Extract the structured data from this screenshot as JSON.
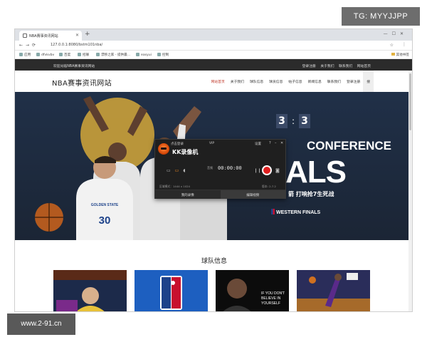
{
  "watermarks": {
    "top_right": "TG: MYYJJPP",
    "bottom_left": "www.2-91.cn"
  },
  "browser": {
    "tab_title": "NBA赛事资讯网站",
    "new_tab": "+",
    "address": "127.0.0.1:8080/bstm101nba/",
    "bookmarks": [
      "应用",
      "dfvkvbv",
      "百度",
      "招联",
      "漂移之家 - 提供最...",
      "easyui",
      "控制"
    ],
    "bookmarks_other": "其他书签"
  },
  "site": {
    "welcome": "欢迎光临NBA赛事资讯网站",
    "top_links": [
      "登录注册",
      "关于我们",
      "联系我们",
      "网站首页"
    ],
    "logo": "NBA赛事资讯网站",
    "nav": [
      "网站首页",
      "关于我们",
      "球队信息",
      "球员信息",
      "帖子信息",
      "新闻信息",
      "联系我们",
      "登录注册",
      "搜"
    ],
    "banner": {
      "score_left": "3",
      "score_right": "3",
      "conference": "CONFERENCE",
      "finals": "ALS",
      "slogan": "箭 打响抢7生死战",
      "western": "WESTERN FINALS"
    },
    "section_title": "球队信息"
  },
  "recorder": {
    "login": "点击登录",
    "vip": "VIP",
    "settings": "设置",
    "title": "KK录像机",
    "audio_label": "音频",
    "timer": "00:00:00",
    "mode_text": "区域模式：1444 x 1024",
    "version": "版本: 2.7.2",
    "btn_left": "我的录像",
    "btn_right": "编辑视频"
  },
  "colors": {
    "accent_red": "#c0392b",
    "record_red": "#e02020",
    "banner_bg": "#203048"
  }
}
